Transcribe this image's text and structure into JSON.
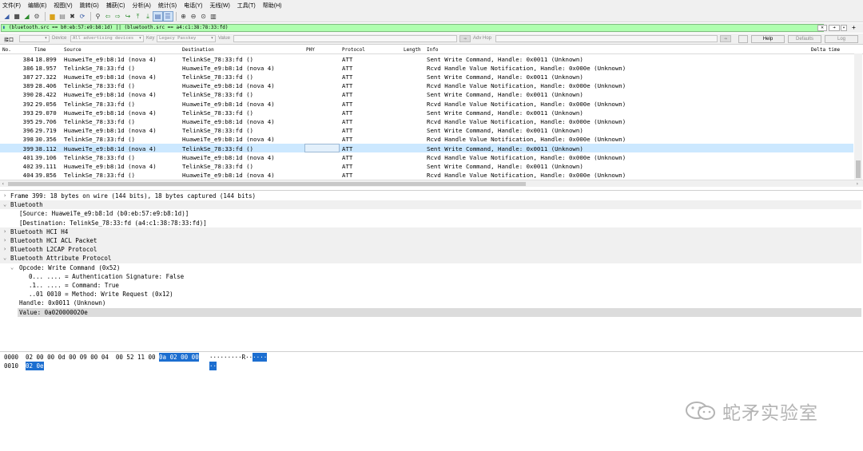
{
  "menu": [
    "文件(F)",
    "编辑(E)",
    "视图(V)",
    "跳转(G)",
    "捕获(C)",
    "分析(A)",
    "统计(S)",
    "电话(Y)",
    "无线(W)",
    "工具(T)",
    "帮助(H)"
  ],
  "filter": {
    "value": "(bluetooth.src == b0:eb:57:e9:b8:1d) || (bluetooth.src == a4:c1:38:78:33:fd)"
  },
  "interface_bar": {
    "label": "接口",
    "device_label": "Device",
    "device_value": "All advertising devices",
    "key_label": "Key",
    "key_value": "Legacy Passkey",
    "value_label": "Value",
    "adv_hop_label": "Adv Hop",
    "help": "Help",
    "defaults": "Defaults",
    "log": "Log"
  },
  "columns": {
    "no": "No.",
    "time": "Time",
    "source": "Source",
    "destination": "Destination",
    "phy": "PHY",
    "protocol": "Protocol",
    "length": "Length",
    "info": "Info",
    "delta": "Delta time"
  },
  "packets": [
    {
      "no": "384",
      "time": "18.899",
      "src": "HuaweiTe_e9:b8:1d (nova 4)",
      "dst": "TelinkSe_78:33:fd ()",
      "proto": "ATT",
      "info": "Sent Write Command, Handle: 0x0011 (Unknown)"
    },
    {
      "no": "386",
      "time": "18.957",
      "src": "TelinkSe_78:33:fd ()",
      "dst": "HuaweiTe_e9:b8:1d (nova 4)",
      "proto": "ATT",
      "info": "Rcvd Handle Value Notification, Handle: 0x000e (Unknown)"
    },
    {
      "no": "387",
      "time": "27.322",
      "src": "HuaweiTe_e9:b8:1d (nova 4)",
      "dst": "TelinkSe_78:33:fd ()",
      "proto": "ATT",
      "info": "Sent Write Command, Handle: 0x0011 (Unknown)"
    },
    {
      "no": "389",
      "time": "28.406",
      "src": "TelinkSe_78:33:fd ()",
      "dst": "HuaweiTe_e9:b8:1d (nova 4)",
      "proto": "ATT",
      "info": "Rcvd Handle Value Notification, Handle: 0x000e (Unknown)"
    },
    {
      "no": "390",
      "time": "28.422",
      "src": "HuaweiTe_e9:b8:1d (nova 4)",
      "dst": "TelinkSe_78:33:fd ()",
      "proto": "ATT",
      "info": "Sent Write Command, Handle: 0x0011 (Unknown)"
    },
    {
      "no": "392",
      "time": "29.056",
      "src": "TelinkSe_78:33:fd ()",
      "dst": "HuaweiTe_e9:b8:1d (nova 4)",
      "proto": "ATT",
      "info": "Rcvd Handle Value Notification, Handle: 0x000e (Unknown)"
    },
    {
      "no": "393",
      "time": "29.070",
      "src": "HuaweiTe_e9:b8:1d (nova 4)",
      "dst": "TelinkSe_78:33:fd ()",
      "proto": "ATT",
      "info": "Sent Write Command, Handle: 0x0011 (Unknown)"
    },
    {
      "no": "395",
      "time": "29.706",
      "src": "TelinkSe_78:33:fd ()",
      "dst": "HuaweiTe_e9:b8:1d (nova 4)",
      "proto": "ATT",
      "info": "Rcvd Handle Value Notification, Handle: 0x000e (Unknown)"
    },
    {
      "no": "396",
      "time": "29.719",
      "src": "HuaweiTe_e9:b8:1d (nova 4)",
      "dst": "TelinkSe_78:33:fd ()",
      "proto": "ATT",
      "info": "Sent Write Command, Handle: 0x0011 (Unknown)"
    },
    {
      "no": "398",
      "time": "30.356",
      "src": "TelinkSe_78:33:fd ()",
      "dst": "HuaweiTe_e9:b8:1d (nova 4)",
      "proto": "ATT",
      "info": "Rcvd Handle Value Notification, Handle: 0x000e (Unknown)"
    },
    {
      "no": "399",
      "time": "38.112",
      "src": "HuaweiTe_e9:b8:1d (nova 4)",
      "dst": "TelinkSe_78:33:fd ()",
      "proto": "ATT",
      "info": "Sent Write Command, Handle: 0x0011 (Unknown)",
      "selected": true
    },
    {
      "no": "401",
      "time": "39.106",
      "src": "TelinkSe_78:33:fd ()",
      "dst": "HuaweiTe_e9:b8:1d (nova 4)",
      "proto": "ATT",
      "info": "Rcvd Handle Value Notification, Handle: 0x000e (Unknown)"
    },
    {
      "no": "402",
      "time": "39.111",
      "src": "HuaweiTe_e9:b8:1d (nova 4)",
      "dst": "TelinkSe_78:33:fd ()",
      "proto": "ATT",
      "info": "Sent Write Command, Handle: 0x0011 (Unknown)"
    },
    {
      "no": "404",
      "time": "39.856",
      "src": "TelinkSe_78:33:fd ()",
      "dst": "HuaweiTe_e9:b8:1d (nova 4)",
      "proto": "ATT",
      "info": "Rcvd Handle Value Notification, Handle: 0x000e (Unknown)"
    }
  ],
  "details": [
    {
      "text": "Frame 399: 18 bytes on wire (144 bits), 18 bytes captured (144 bits)",
      "level": 0,
      "exp": "›",
      "style": "white"
    },
    {
      "text": "Bluetooth",
      "level": 0,
      "exp": "⌄",
      "style": "grey"
    },
    {
      "text": "[Source: HuaweiTe_e9:b8:1d (b0:eb:57:e9:b8:1d)]",
      "level": 1,
      "exp": "",
      "style": "white"
    },
    {
      "text": "[Destination: TelinkSe_78:33:fd (a4:c1:38:78:33:fd)]",
      "level": 1,
      "exp": "",
      "style": "white"
    },
    {
      "text": "Bluetooth HCI H4",
      "level": 0,
      "exp": "›",
      "style": "grey"
    },
    {
      "text": "Bluetooth HCI ACL Packet",
      "level": 0,
      "exp": "›",
      "style": "grey"
    },
    {
      "text": "Bluetooth L2CAP Protocol",
      "level": 0,
      "exp": "›",
      "style": "grey"
    },
    {
      "text": "Bluetooth Attribute Protocol",
      "level": 0,
      "exp": "⌄",
      "style": "grey"
    },
    {
      "text": "Opcode: Write Command (0x52)",
      "level": 1,
      "exp": "⌄",
      "style": "white"
    },
    {
      "text": "0... .... = Authentication Signature: False",
      "level": 2,
      "exp": "",
      "style": "white"
    },
    {
      "text": ".1.. .... = Command: True",
      "level": 2,
      "exp": "",
      "style": "white"
    },
    {
      "text": "..01 0010 = Method: Write Request (0x12)",
      "level": 2,
      "exp": "",
      "style": "white"
    },
    {
      "text": "Handle: 0x0011 (Unknown)",
      "level": 1,
      "exp": "",
      "style": "white"
    },
    {
      "text": "Value: 0a020000020e",
      "level": 1,
      "exp": "",
      "style": "highlight"
    }
  ],
  "bytes": [
    {
      "offset": "0000",
      "hex": "02 00 00 0d 00 09 00 04  00 52 11 00 ",
      "hex_sel": "0a 02 00 00",
      "ascii": "·········R··",
      "ascii_sel": "····"
    },
    {
      "offset": "0010",
      "hex": "",
      "hex_sel": "02 0e",
      "ascii": "",
      "ascii_sel": "··"
    }
  ],
  "watermark": "蛇矛实验室",
  "colors": {
    "filter_ok": "#afffaf",
    "selected_row": "#cce8ff",
    "byte_highlight": "#1c6ed0"
  }
}
